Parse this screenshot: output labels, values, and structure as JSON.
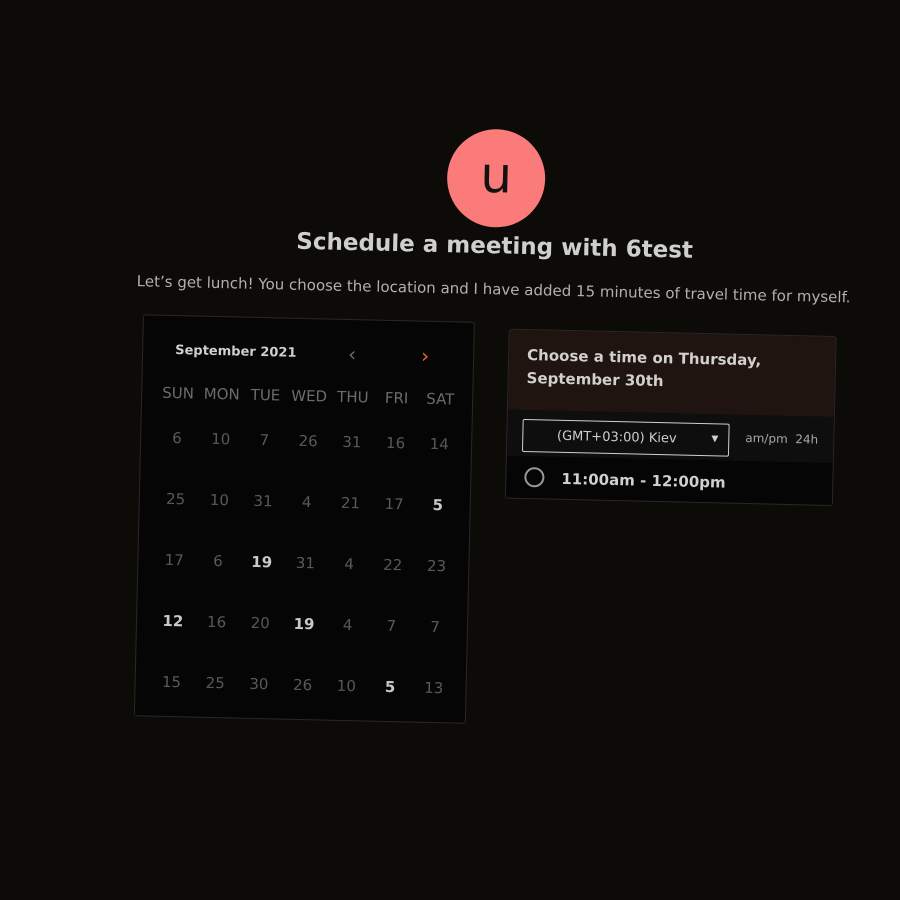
{
  "profile": {
    "avatar_letter": "u",
    "avatar_color": "#fb7a7a"
  },
  "header": {
    "title": "Schedule a meeting with 6test",
    "subtitle": "Let’s get lunch! You choose the location and I have added 15 minutes of travel time for myself."
  },
  "calendar": {
    "month_label": "September 2021",
    "prev_icon": "chevron-left",
    "next_icon": "chevron-right",
    "accent_color": "#e8662a",
    "weekdays": [
      "SUN",
      "MON",
      "TUE",
      "WED",
      "THU",
      "FRI",
      "SAT"
    ],
    "days": [
      "6",
      "10",
      "7",
      "26",
      "31",
      "16",
      "14",
      "25",
      "10",
      "31",
      "4",
      "21",
      "17",
      "5",
      "17",
      "6",
      "19",
      "31",
      "4",
      "22",
      "23",
      "12",
      "16",
      "20",
      "19",
      "4",
      "7",
      "7",
      "15",
      "25",
      "30",
      "26",
      "10",
      "5",
      "13"
    ],
    "active_days": [
      13,
      16,
      21,
      24,
      33
    ]
  },
  "timepicker": {
    "heading": "Choose a time on Thursday, September 30th",
    "timezone": "(GMT+03:00) Kiev",
    "format_ampm": "am/pm",
    "format_24h": "24h",
    "slots": [
      "11:00am - 12:00pm"
    ]
  }
}
